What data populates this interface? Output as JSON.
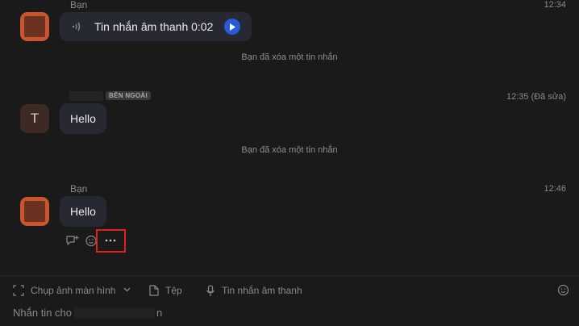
{
  "messages": [
    {
      "sender": "Bạn",
      "time": "12:34",
      "voice_label": "Tin nhắn âm thanh 0:02"
    },
    {
      "system": "Bạn đã xóa một tin nhắn"
    },
    {
      "badge": "BÊN NGOÀI",
      "avatar_initial": "T",
      "time": "12:35 (Đã sửa)",
      "text": "Hello"
    },
    {
      "system": "Bạn đã xóa một tin nhắn"
    },
    {
      "sender": "Bạn",
      "time": "12:46",
      "text": "Hello"
    }
  ],
  "composer": {
    "screenshot_label": "Chụp ảnh màn hình",
    "file_label": "Tệp",
    "voice_label": "Tin nhắn âm thanh",
    "placeholder_prefix": "Nhắn tin cho",
    "placeholder_suffix": "n"
  },
  "colors": {
    "background": "#1a1a1a",
    "bubble": "#262932",
    "play_button": "#2a5bd7",
    "highlight": "#e32020"
  }
}
